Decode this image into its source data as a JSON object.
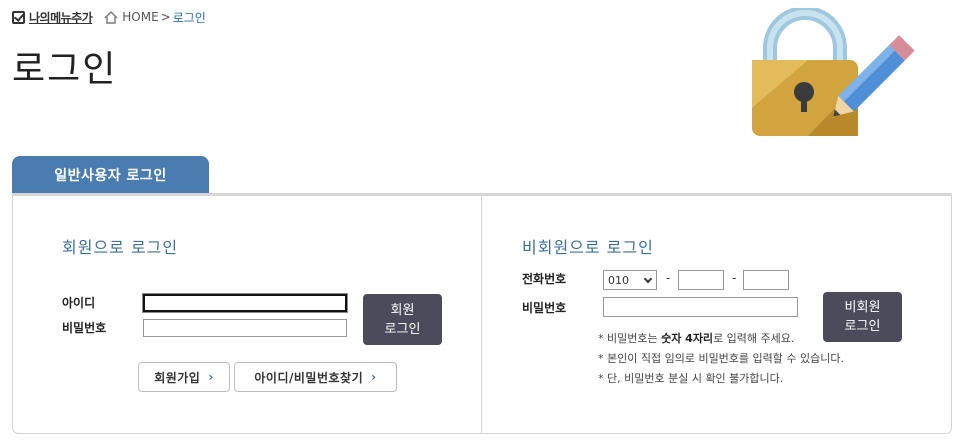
{
  "topnav": {
    "my_menu_label": "나의메뉴추가",
    "home_label": "HOME",
    "separator": ">",
    "current_label": "로그인"
  },
  "page": {
    "title": "로그인"
  },
  "tabs": [
    {
      "label": "일반사용자 로그인",
      "active": true
    }
  ],
  "member_login": {
    "title": "회원으로 로그인",
    "id_label": "아이디",
    "id_value": "",
    "pw_label": "비밀번호",
    "pw_value": "",
    "login_button_line1": "회원",
    "login_button_line2": "로그인",
    "signup_button": "회원가입",
    "find_button": "아이디/비밀번호찾기",
    "chevron": "›"
  },
  "guest_login": {
    "title": "비회원으로 로그인",
    "phone_label": "전화번호",
    "phone_prefix_selected": "010",
    "phone_dash": "-",
    "phone_mid": "",
    "phone_last": "",
    "pw_label": "비밀번호",
    "pw_value": "",
    "login_button_line1": "비회원",
    "login_button_line2": "로그인",
    "notes": [
      {
        "prefix": "* 비밀번호는 ",
        "bold": "숫자 4자리",
        "suffix": "로 입력해 주세요."
      },
      {
        "prefix": "* 본인이 직접 임의로 비밀번호를 입력할 수 있습니다.",
        "bold": "",
        "suffix": ""
      },
      {
        "prefix": "* 단, 비밀번호 분실 시 확인 불가합니다.",
        "bold": "",
        "suffix": ""
      }
    ]
  },
  "icons": {
    "checkbox": "checkbox-icon",
    "home": "home-icon",
    "illustration": "lock-pencil-illustration"
  },
  "colors": {
    "tab_bg": "#4a7cb0",
    "section_title": "#3c6e9e",
    "dark_button": "#4b4b5b",
    "breadcrumb_current": "#2c6aa8"
  }
}
